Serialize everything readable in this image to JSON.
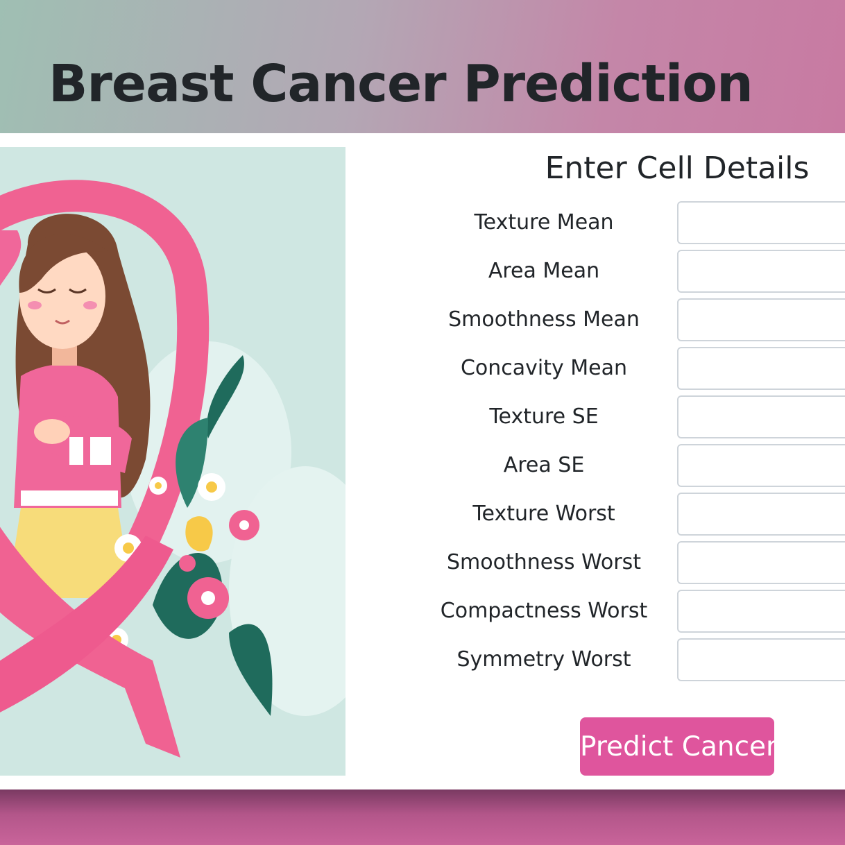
{
  "header": {
    "title": "Breast Cancer Prediction"
  },
  "illustration": {
    "description_icon": "pink-ribbon-woman-illustration"
  },
  "form": {
    "title": "Enter Cell Details",
    "fields": [
      {
        "label": "Texture Mean",
        "value": ""
      },
      {
        "label": "Area Mean",
        "value": ""
      },
      {
        "label": "Smoothness Mean",
        "value": ""
      },
      {
        "label": "Concavity Mean",
        "value": ""
      },
      {
        "label": "Texture SE",
        "value": ""
      },
      {
        "label": "Area SE",
        "value": ""
      },
      {
        "label": "Texture Worst",
        "value": ""
      },
      {
        "label": "Smoothness Worst",
        "value": ""
      },
      {
        "label": "Compactness Worst",
        "value": ""
      },
      {
        "label": "Symmetry Worst",
        "value": ""
      }
    ],
    "submit_label": "Predict Cancer"
  },
  "colors": {
    "accent": "#df559d",
    "header_gradient_start": "#9fbfb3",
    "header_gradient_end": "#c87aa2",
    "footer": "#b3568a",
    "illustration_bg": "#cfe7e2"
  }
}
